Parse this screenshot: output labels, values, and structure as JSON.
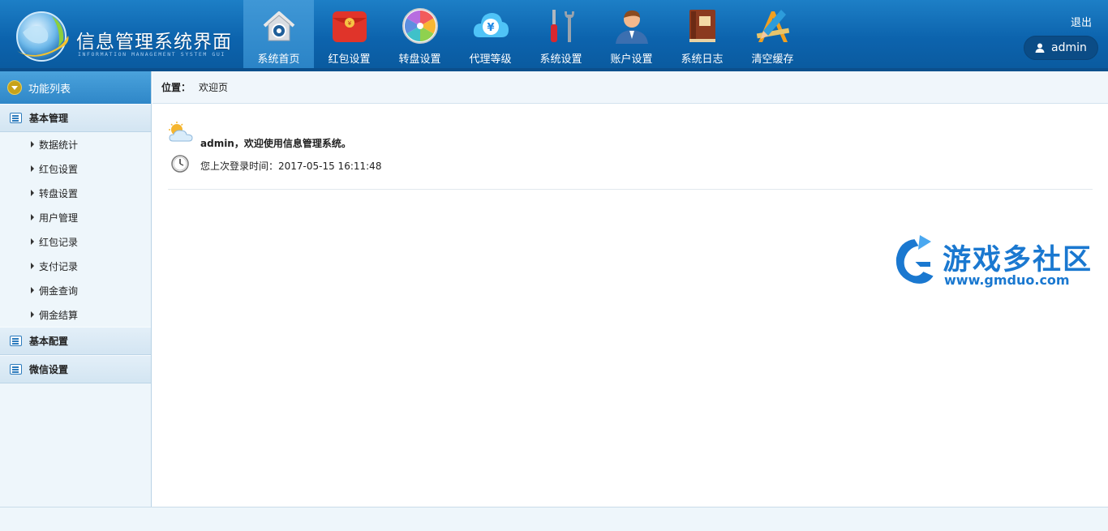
{
  "header": {
    "title": "信息管理系统界面",
    "subtitle": "INFORMATION MANAGEMENT SYSTEM GUI",
    "logout_label": "退出",
    "username": "admin",
    "nav": [
      {
        "label": "系统首页",
        "icon": "home-icon",
        "active": true
      },
      {
        "label": "红包设置",
        "icon": "red-envelope-icon",
        "active": false
      },
      {
        "label": "转盘设置",
        "icon": "wheel-icon",
        "active": false
      },
      {
        "label": "代理等级",
        "icon": "yen-cloud-icon",
        "active": false
      },
      {
        "label": "系统设置",
        "icon": "tools-icon",
        "active": false
      },
      {
        "label": "账户设置",
        "icon": "user-icon",
        "active": false
      },
      {
        "label": "系统日志",
        "icon": "book-icon",
        "active": false
      },
      {
        "label": "清空缓存",
        "icon": "design-tools-icon",
        "active": false
      }
    ]
  },
  "sidebar": {
    "title": "功能列表",
    "groups": [
      {
        "label": "基本管理",
        "items": [
          "数据统计",
          "红包设置",
          "转盘设置",
          "用户管理",
          "红包记录",
          "支付记录",
          "佣金查询",
          "佣金结算"
        ]
      },
      {
        "label": "基本配置",
        "items": []
      },
      {
        "label": "微信设置",
        "items": []
      }
    ]
  },
  "main": {
    "breadcrumb_label": "位置：",
    "breadcrumb_value": "欢迎页",
    "welcome_user": "admin",
    "welcome_text": "，欢迎使用信息管理系统。",
    "last_login": "您上次登录时间：2017-05-15 16:11:48"
  },
  "watermark": {
    "name": "游戏多社区",
    "url": "www.gmduo.com"
  },
  "colors": {
    "header_blue": "#0c63ad",
    "active_tab_underline": "#7fd343",
    "sidebar_bg": "#eef6fb",
    "watermark_blue": "#1a78d0"
  }
}
